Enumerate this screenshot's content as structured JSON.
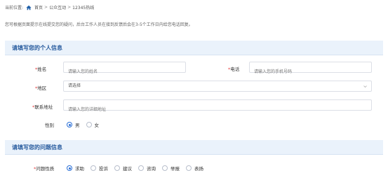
{
  "breadcrumb": {
    "prefix": "当前位置:",
    "items": [
      "首页",
      "公众互动",
      "12345热线"
    ],
    "separator": ">"
  },
  "notice": "您可根据页面提示在线提交您的疑问，后台工作人员在接到反馈后会在3-5个工作日内给您电话回复。",
  "personal_section": {
    "title": "请填写您的个人信息"
  },
  "fields": {
    "name": {
      "label": "姓名",
      "placeholder": "请输入您的姓名"
    },
    "phone": {
      "label": "电话",
      "placeholder": "请输入您的手机号码"
    },
    "district": {
      "label": "地区",
      "value": "请选择"
    },
    "address": {
      "label": "联系地址",
      "placeholder": "请输入您的详细地址"
    },
    "gender": {
      "label": "性别",
      "options": [
        "男",
        "女"
      ],
      "selected": "男"
    }
  },
  "question_section": {
    "title": "请填写您的问题信息"
  },
  "question_type": {
    "label": "问题性质",
    "options": [
      "求助",
      "投诉",
      "建议",
      "咨询",
      "举报",
      "表扬"
    ],
    "selected": "求助"
  },
  "colors": {
    "accent": "#2a6fd6",
    "section_bg": "#eaf2fb",
    "required": "#e23b3b"
  }
}
